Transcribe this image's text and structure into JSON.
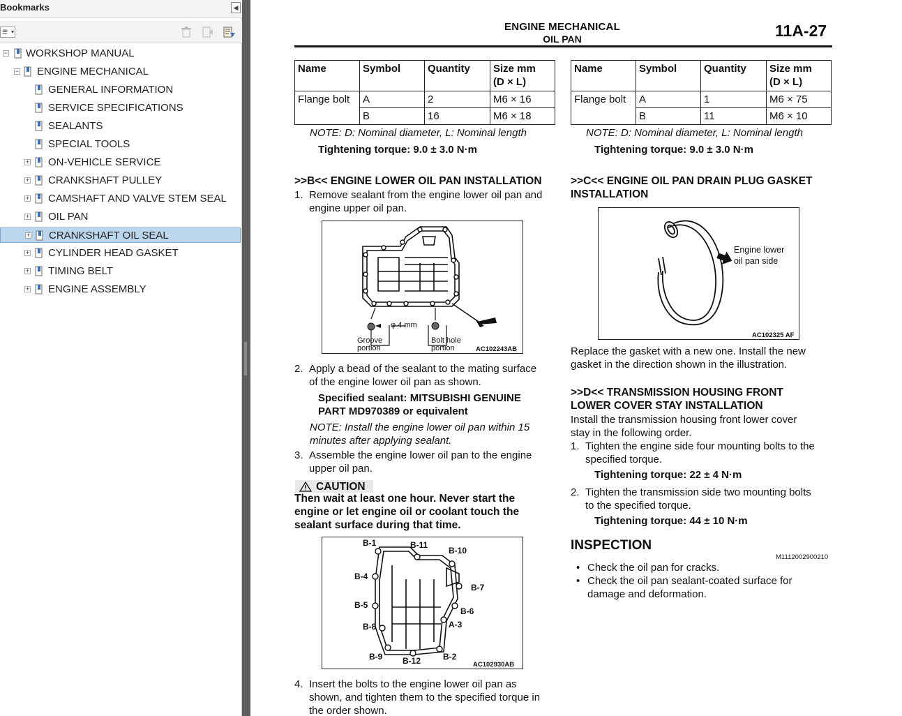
{
  "bookmarks_panel": {
    "title": "Bookmarks",
    "collapse_icon": "chevron-left-icon",
    "toolbar": {
      "options_icon": "options-menu-icon",
      "delete_icon": "delete-bookmark-icon",
      "new_icon": "new-bookmark-icon",
      "expand_icon": "expand-bookmark-icon"
    },
    "items": [
      {
        "label": "WORKSHOP MANUAL",
        "toggle": "−"
      },
      {
        "label": "ENGINE MECHANICAL",
        "toggle": "−"
      },
      {
        "label": "GENERAL INFORMATION",
        "toggle": ""
      },
      {
        "label": "SERVICE SPECIFICATIONS",
        "toggle": ""
      },
      {
        "label": "SEALANTS",
        "toggle": ""
      },
      {
        "label": "SPECIAL TOOLS",
        "toggle": ""
      },
      {
        "label": "ON-VEHICLE SERVICE",
        "toggle": "+"
      },
      {
        "label": "CRANKSHAFT PULLEY",
        "toggle": "+"
      },
      {
        "label": "CAMSHAFT AND VALVE STEM SEAL",
        "toggle": "+"
      },
      {
        "label": "OIL PAN",
        "toggle": "+"
      },
      {
        "label": "CRANKSHAFT OIL SEAL",
        "toggle": "+",
        "selected": true
      },
      {
        "label": "CYLINDER HEAD GASKET",
        "toggle": "+"
      },
      {
        "label": "TIMING BELT",
        "toggle": "+"
      },
      {
        "label": "ENGINE ASSEMBLY",
        "toggle": "+"
      }
    ]
  },
  "document": {
    "header": {
      "title": "ENGINE MECHANICAL",
      "subtitle": "OIL PAN",
      "page_number": "11A-27"
    },
    "table_headers": {
      "name": "Name",
      "symbol": "Symbol",
      "quantity": "Quantity",
      "size": "Size mm",
      "size_unit": "(D × L)"
    },
    "left_table": [
      {
        "name": "Flange bolt",
        "symbol": "A",
        "quantity": "2",
        "size": "M6 × 16"
      },
      {
        "name": "",
        "symbol": "B",
        "quantity": "16",
        "size": "M6 × 18"
      }
    ],
    "right_table": [
      {
        "name": "Flange bolt",
        "symbol": "A",
        "quantity": "1",
        "size": "M6 × 75"
      },
      {
        "name": "",
        "symbol": "B",
        "quantity": "11",
        "size": "M6 × 10"
      }
    ],
    "note_nominal": "NOTE: D: Nominal diameter, L: Nominal length",
    "torque_9": "Tightening torque: 9.0 ± 3.0 N·m",
    "sec_b": {
      "heading": ">>B<< ENGINE LOWER OIL PAN INSTALLATION",
      "step1_num": "1.",
      "step1_l1": "Remove sealant from the engine lower oil pan and",
      "step1_l2": "engine upper oil pan.",
      "fig1": {
        "code": "AC102243AB",
        "dia": "φ 4 mm",
        "groove_1": "Groove",
        "groove_2": "portion",
        "bolt_1": "Bolt hole",
        "bolt_2": "portion"
      },
      "step2_num": "2.",
      "step2_l1": "Apply a bead of the sealant to the mating surface",
      "step2_l2": "of the engine lower oil pan as shown.",
      "sealant_l1": "Specified sealant: MITSUBISHI GENUINE",
      "sealant_l2": "PART MD970389 or equivalent",
      "note2_l1": "NOTE: Install the engine lower oil pan within 15",
      "note2_l2": "minutes after applying sealant.",
      "step3_num": "3.",
      "step3_l1": "Assemble the engine lower oil pan to the engine",
      "step3_l2": "upper oil pan.",
      "caution_title": "CAUTION",
      "caution_icon": "warning-triangle-icon",
      "caution_l1": "Then wait at least one hour. Never start the",
      "caution_l2": "engine or let engine oil or coolant touch the",
      "caution_l3": "sealant surface during that time.",
      "fig2": {
        "code": "AC102930AB",
        "labels": [
          "B-1",
          "B-11",
          "B-10",
          "B-4",
          "B-7",
          "B-5",
          "B-6",
          "A-3",
          "B-8",
          "B-9",
          "B-12",
          "B-2"
        ]
      },
      "step4_num": "4.",
      "step4_l1": "Insert the bolts to the engine lower oil pan as",
      "step4_l2": "shown, and tighten them to the specified torque in",
      "step4_l3": "the order shown."
    },
    "sec_c": {
      "heading_l1": ">>C<< ENGINE OIL PAN DRAIN PLUG GASKET",
      "heading_l2": "INSTALLATION",
      "fig3": {
        "code": "AC102325 AF",
        "label_1": "Engine lower",
        "label_2": "oil pan side"
      },
      "text_l1": "Replace the gasket with a new one. Install the new",
      "text_l2": "gasket in the direction shown in the illustration."
    },
    "sec_d": {
      "heading_l1": ">>D<< TRANSMISSION HOUSING FRONT",
      "heading_l2": "LOWER COVER STAY INSTALLATION",
      "intro_l1": "Install the transmission housing front lower cover",
      "intro_l2": "stay in the following order.",
      "step1_num": "1.",
      "step1_l1": "Tighten the engine side four mounting bolts to the",
      "step1_l2": "specified torque.",
      "torque1": "Tightening torque: 22 ± 4 N·m",
      "step2_num": "2.",
      "step2_l1": "Tighten the transmission side two mounting bolts",
      "step2_l2": "to the specified torque.",
      "torque2": "Tightening torque: 44 ± 10 N·m"
    },
    "inspection": {
      "heading": "INSPECTION",
      "code": "M1112002900210",
      "bullet1": "Check the oil pan for cracks.",
      "bullet2_l1": "Check the oil pan sealant-coated surface for",
      "bullet2_l2": "damage and deformation."
    }
  }
}
